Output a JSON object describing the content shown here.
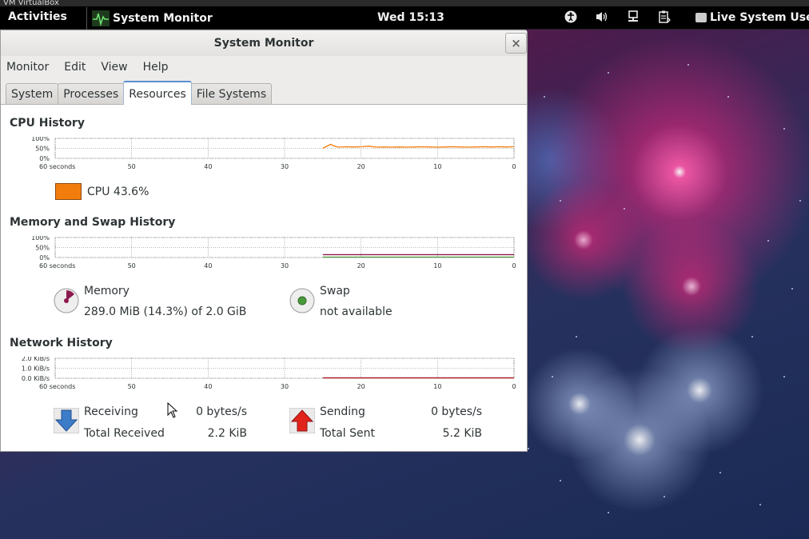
{
  "topbar": {
    "vbox_title": "VM VirtualBox",
    "activities": "Activities",
    "app_name": "System Monitor",
    "clock": "Wed 15:13",
    "user": "Live System User",
    "tray_icons": [
      "accessibility-icon",
      "volume-icon",
      "network-wired-icon",
      "clipboard-icon"
    ]
  },
  "window": {
    "title": "System Monitor",
    "close_glyph": "×",
    "menu": [
      "Monitor",
      "Edit",
      "View",
      "Help"
    ],
    "tabs": [
      "System",
      "Processes",
      "Resources",
      "File Systems"
    ],
    "active_tab": "Resources"
  },
  "axis": {
    "x_ticks": [
      "60 seconds",
      "50",
      "40",
      "30",
      "20",
      "10",
      "0"
    ],
    "percent_ticks": [
      "100%",
      "50%",
      "0%"
    ],
    "network_ticks": [
      "2.0 KiB/s",
      "1.0 KiB/s",
      "0.0 KiB/s"
    ]
  },
  "cpu": {
    "title": "CPU History",
    "label": "CPU",
    "value": "43.6%",
    "color": "#f37d0c",
    "history_x": [
      25,
      24.5,
      24,
      23.5,
      23,
      22,
      21,
      20,
      19,
      18,
      17,
      16,
      15,
      14,
      13,
      12,
      11,
      10,
      9,
      8,
      7,
      6,
      5,
      4,
      3,
      2,
      1,
      0
    ],
    "history_y": [
      50,
      60,
      70,
      62,
      56,
      58,
      57,
      58,
      61,
      56,
      57,
      56,
      57,
      56,
      57,
      58,
      57,
      56,
      57,
      58,
      57,
      56,
      57,
      58,
      57,
      58,
      57,
      58
    ]
  },
  "memory": {
    "title": "Memory and Swap History",
    "mem_label": "Memory",
    "mem_value": "289.0 MiB (14.3%) of 2.0 GiB",
    "mem_percent": 14.3,
    "mem_color": "#8b1a4d",
    "swap_label": "Swap",
    "swap_value": "not available",
    "swap_percent": 0,
    "swap_color": "#4a9a3a",
    "history_start": 25
  },
  "network": {
    "title": "Network History",
    "receiving_label": "Receiving",
    "receiving_value": "0 bytes/s",
    "total_received_label": "Total Received",
    "total_received_value": "2.2 KiB",
    "sending_label": "Sending",
    "sending_value": "0 bytes/s",
    "total_sent_label": "Total Sent",
    "total_sent_value": "5.2 KiB",
    "receive_color": "#2a5db0",
    "send_color": "#c21a1a",
    "history_start": 25
  }
}
